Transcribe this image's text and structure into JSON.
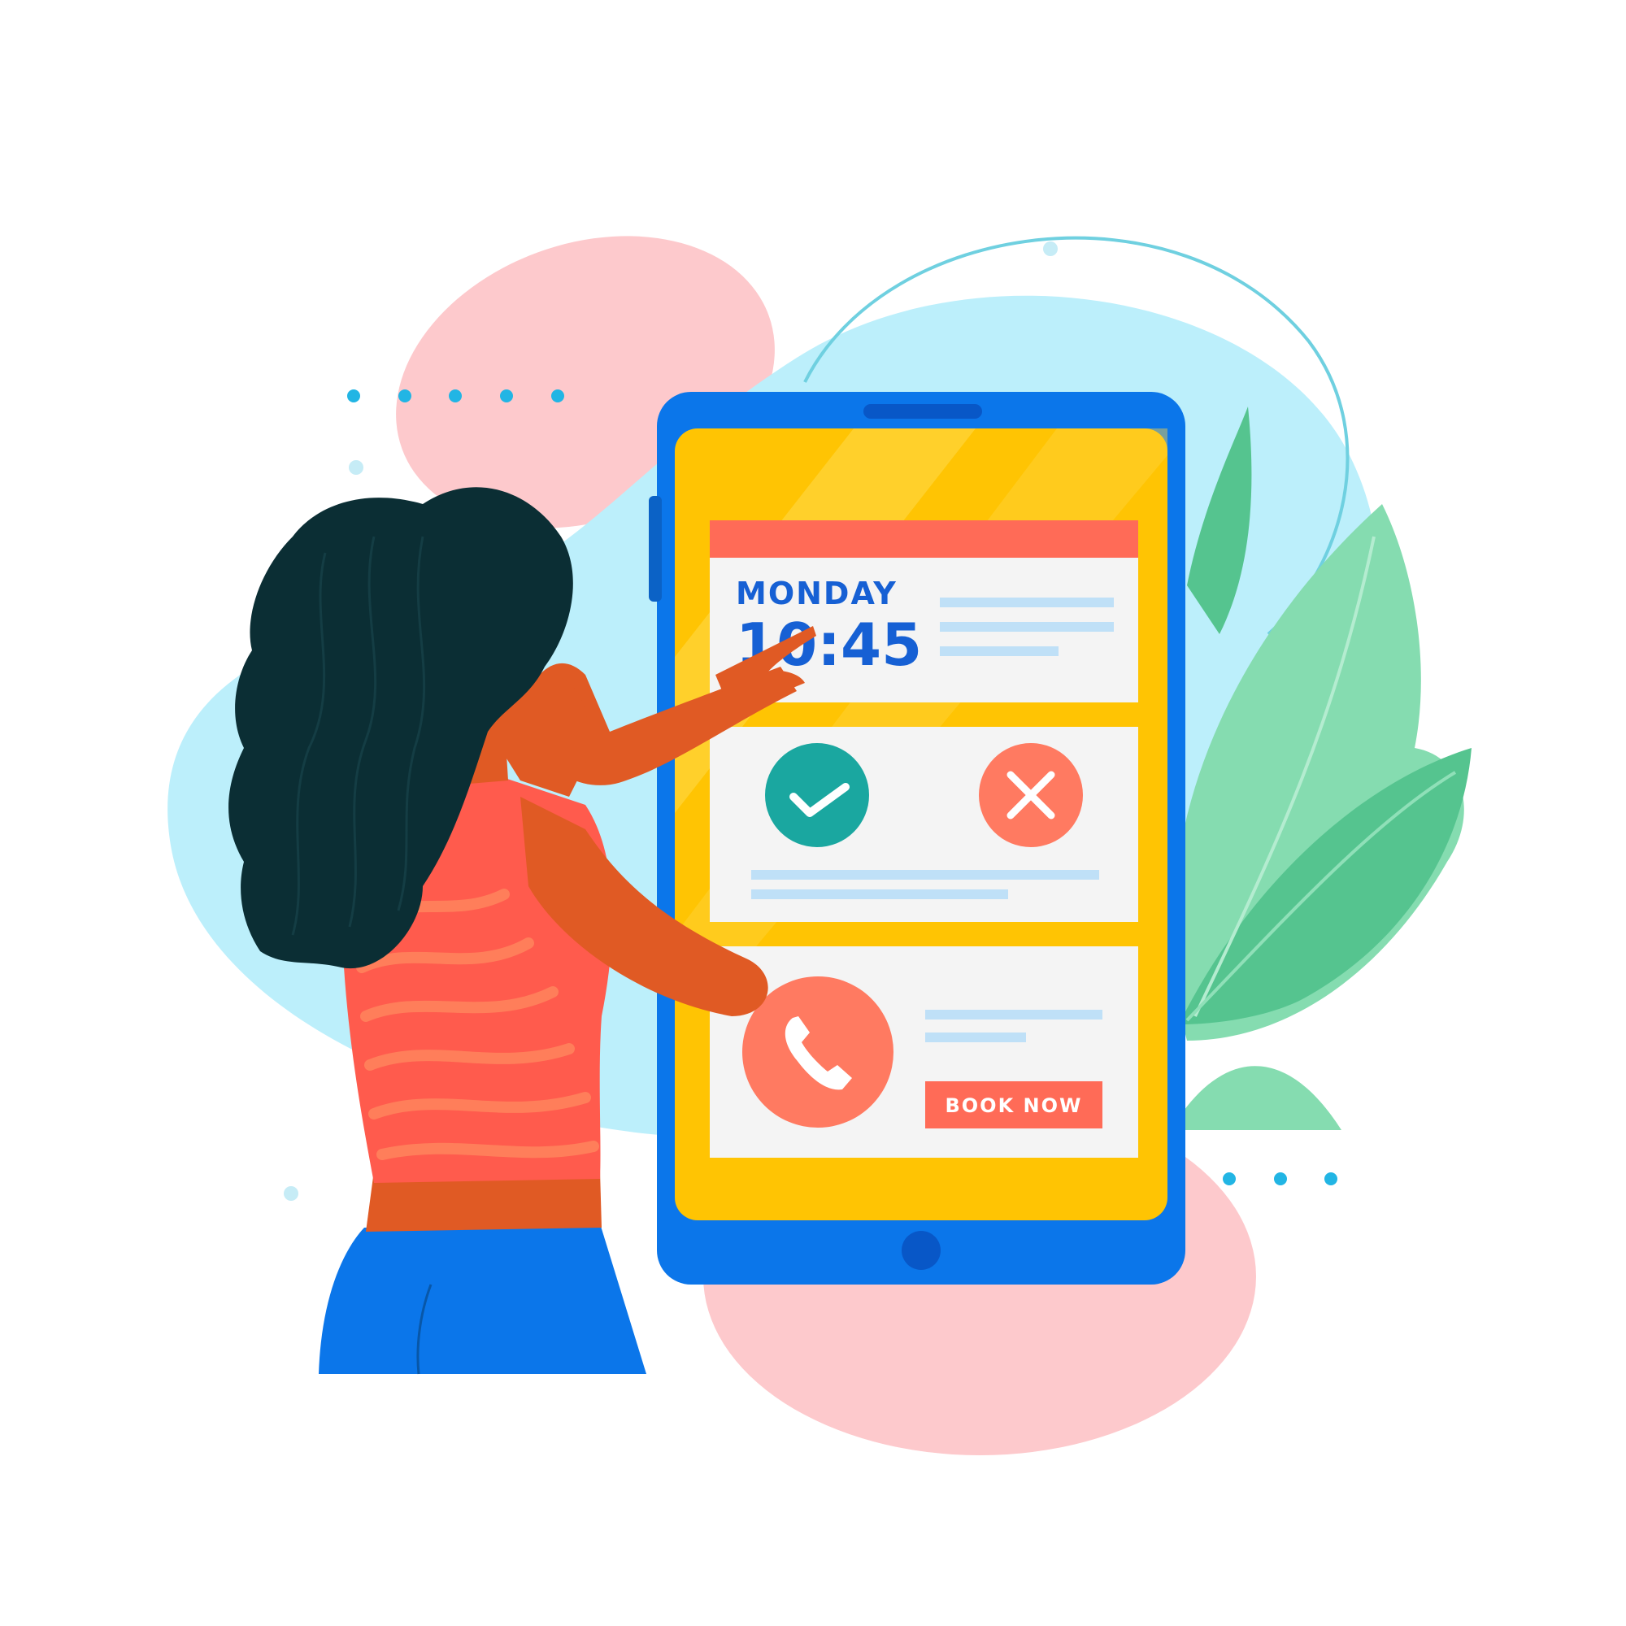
{
  "appointment": {
    "day": "MONDAY",
    "time": "10:45"
  },
  "actions": {
    "confirm_icon": "check-icon",
    "cancel_icon": "close-icon",
    "call_icon": "phone-icon",
    "book_label": "BOOK NOW"
  },
  "colors": {
    "phone_frame": "#0b76ea",
    "phone_screen": "#ffc403",
    "card_header": "#ff6b57",
    "confirm": "#1aa7a0",
    "cancel": "#ff7a61",
    "call": "#ff7a61",
    "book_button": "#ff6b57",
    "heading_text": "#1660d4",
    "placeholder_lines": "#bfe0f7",
    "blob_pink": "#fdc9cc",
    "blob_blue": "#bceffb",
    "leaf_green": "#55c48f"
  }
}
